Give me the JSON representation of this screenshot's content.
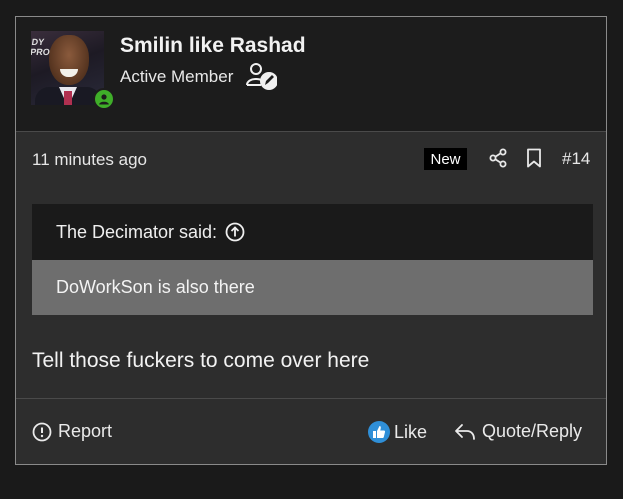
{
  "post": {
    "user": {
      "name": "Smilin like Rashad",
      "title": "Active Member",
      "avatar_text": "DY\nPRO",
      "online": true
    },
    "meta": {
      "timestamp": "11 minutes ago",
      "badge": "New",
      "number": "#14"
    },
    "quote": {
      "author": "The Decimator said:",
      "text": "DoWorkSon is also there"
    },
    "message": "Tell those fuckers to come over here",
    "actions": {
      "report": "Report",
      "like": "Like",
      "reply": "Quote/Reply"
    }
  },
  "colors": {
    "online": "#3fae29",
    "like": "#2f8fd8",
    "quote_body_bg": "#6e6e6e",
    "header_bg": "#1c1c1c"
  },
  "icons": [
    "member-badge-icon",
    "online-status-icon",
    "share-icon",
    "bookmark-icon",
    "arrow-up-circle-icon",
    "alert-circle-icon",
    "thumbs-up-icon",
    "reply-icon"
  ]
}
